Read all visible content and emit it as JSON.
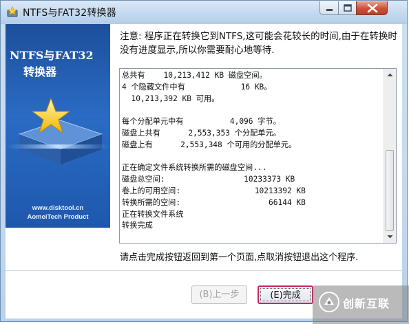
{
  "window": {
    "title": "NTFS与FAT32转换器",
    "controls": {
      "minimize": "minimize",
      "maximize": "maximize",
      "close": "close"
    }
  },
  "banner": {
    "title_line1": "NTFS与FAT32",
    "title_line2": "转换器",
    "url": "www.disktool.cn",
    "company": "AomeiTech Product"
  },
  "notice": "注意: 程序正在转换它到NTFS,这可能会花较长的时间,由于在转换时没有进度显示,所以你需要耐心地等待.",
  "log": {
    "lines": [
      "总共有    10,213,412 KB 磁盘空间。",
      "4 个隐藏文件中有            16 KB。",
      "  10,213,392 KB 可用。",
      "",
      "每个分配单元中有          4,096 字节。",
      "磁盘上共有      2,553,353 个分配单元。",
      "磁盘上有      2,553,348 个可用的分配单元。",
      "",
      "正在确定文件系统转换所需的磁盘空间...",
      "磁盘总空间:                 10233373 KB",
      "卷上的可用空间:                10213392 KB",
      "转换所需的空间:                   66144 KB",
      "正在转换文件系统",
      "转换完成"
    ]
  },
  "hint": "请点击完成按钮返回到第一个页面,点取消按钮退出这个程序.",
  "buttons": {
    "back": "(B)上一步",
    "finish": "(E)完成"
  },
  "watermark": {
    "text": "创新互联"
  },
  "colors": {
    "banner": "#2b6bc4",
    "finish_focus": "#cc2266",
    "close_button": "#c9533a"
  }
}
